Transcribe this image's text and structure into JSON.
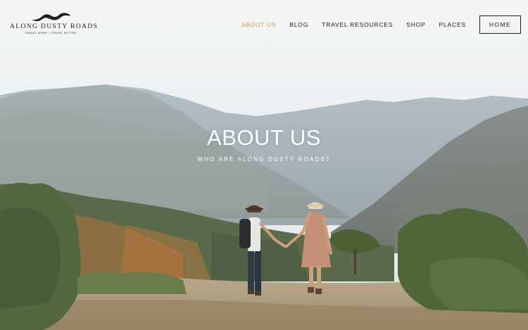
{
  "brand": {
    "name": "ALONG DUSTY ROADS",
    "tagline": "TRAVEL MORE • TRAVEL BETTER"
  },
  "nav": {
    "items": [
      {
        "label": "ABOUT US",
        "active": true
      },
      {
        "label": "BLOG"
      },
      {
        "label": "TRAVEL RESOURCES"
      },
      {
        "label": "SHOP"
      },
      {
        "label": "PLACES"
      }
    ],
    "home_label": "HOME"
  },
  "hero": {
    "title": "ABOUT US",
    "subtitle": "WHO ARE ALONG DUSTY ROADS?"
  },
  "colors": {
    "accent": "#d99a4a",
    "text_dark": "#1d1d1d",
    "hero_text": "#ffffff"
  }
}
